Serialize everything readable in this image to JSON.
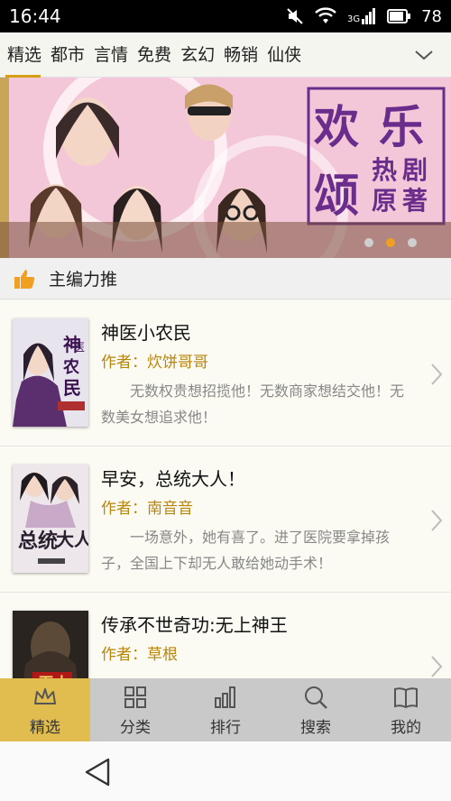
{
  "status_bar": {
    "time": "16:44",
    "network": "3G",
    "battery": "78"
  },
  "tabs": [
    {
      "label": "精选",
      "active": true
    },
    {
      "label": "都市",
      "active": false
    },
    {
      "label": "言情",
      "active": false
    },
    {
      "label": "免费",
      "active": false
    },
    {
      "label": "玄幻",
      "active": false
    },
    {
      "label": "畅销",
      "active": false
    },
    {
      "label": "仙侠",
      "active": false
    }
  ],
  "banner": {
    "headline": [
      "欢",
      "乐",
      "颂",
      "热",
      "剧",
      "原",
      "著"
    ],
    "slide_index": 2,
    "slide_count": 3
  },
  "section": {
    "title": "主编力推",
    "icon": "thumbs-up-icon"
  },
  "books": [
    {
      "title": "神医小农民",
      "author_prefix": "作者：",
      "author": "炊饼哥哥",
      "description": "无数权贵想招揽他！无数商家想结交他！无数美女想追求他！",
      "cover_text": "神医小农民"
    },
    {
      "title": "早安，总统大人！",
      "author_prefix": "作者：",
      "author": "南音音",
      "description": "一场意外，她有喜了。进了医院要拿掉孩子，全国上下却无人敢给她动手术！",
      "cover_text": "总统大人"
    },
    {
      "title": "传承不世奇功:无上神王",
      "author_prefix": "作者：",
      "author": "草根",
      "description": "",
      "cover_text": "无上"
    }
  ],
  "bottom_nav": [
    {
      "label": "精选",
      "icon": "crown-icon",
      "active": true
    },
    {
      "label": "分类",
      "icon": "grid-icon",
      "active": false
    },
    {
      "label": "排行",
      "icon": "bar-chart-icon",
      "active": false
    },
    {
      "label": "搜索",
      "icon": "search-icon",
      "active": false
    },
    {
      "label": "我的",
      "icon": "book-icon",
      "active": false
    }
  ],
  "colors": {
    "accent": "#d4a017",
    "author": "#b8860b",
    "nav_active": "#e0bd4e",
    "nav_bg": "#c9c9c9",
    "dot_active": "#f0a020"
  }
}
